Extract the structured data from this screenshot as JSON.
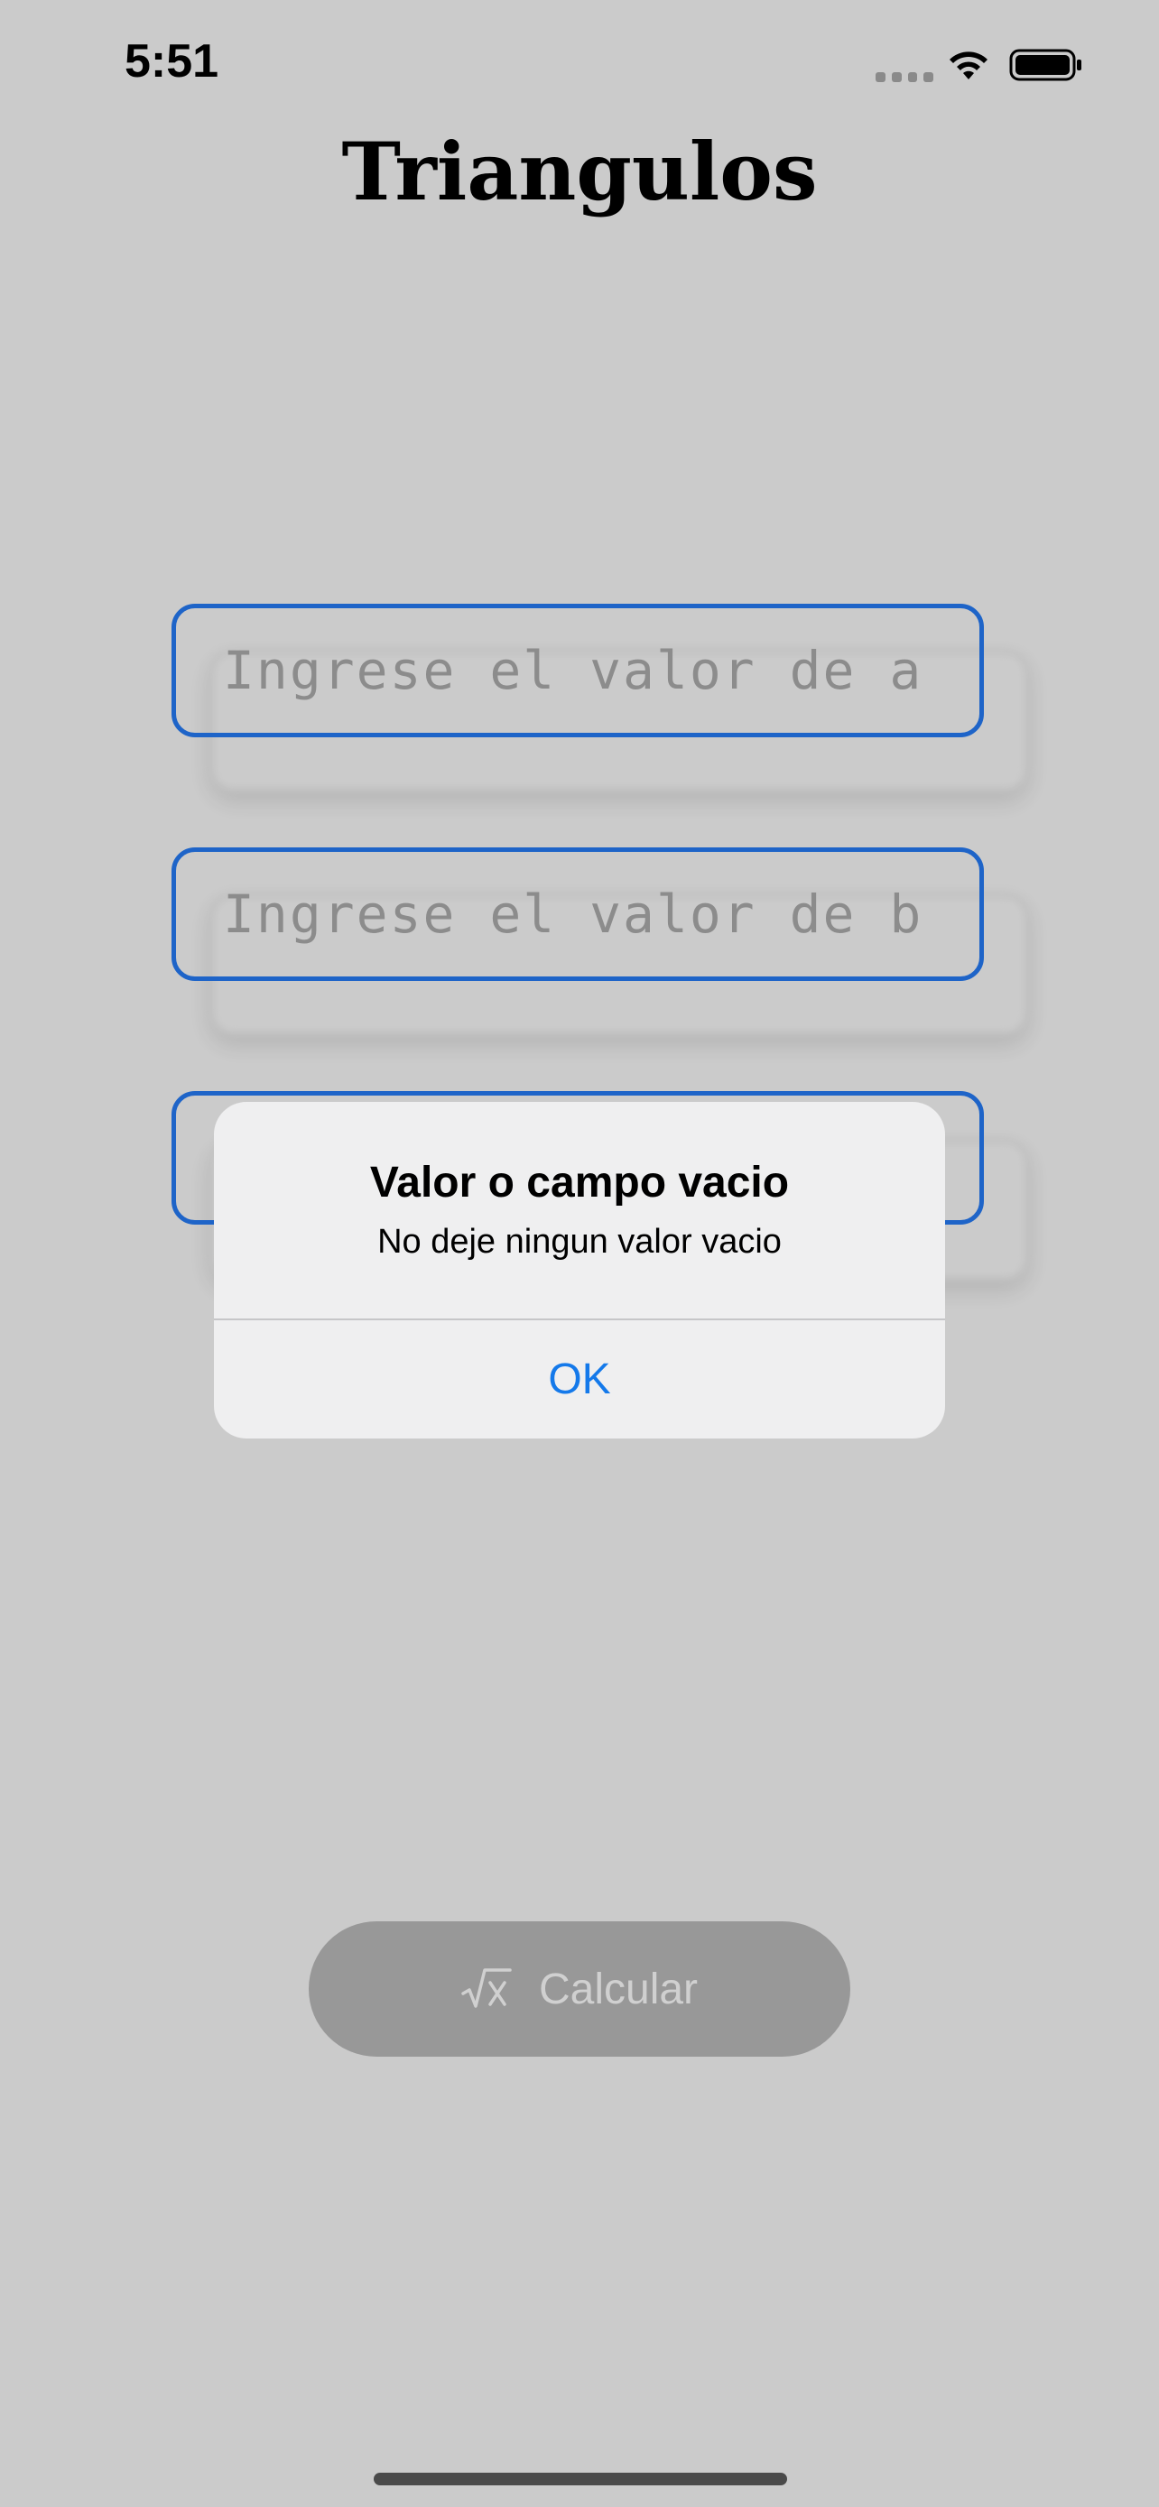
{
  "status_bar": {
    "time": "5:51",
    "signal_icon": "cellular-signal-icon",
    "wifi_icon": "wifi-icon",
    "battery_icon": "battery-icon"
  },
  "app": {
    "title": "Triangulos"
  },
  "fields": [
    {
      "placeholder": "Ingrese el valor de a",
      "value": ""
    },
    {
      "placeholder": "Ingrese el valor de b",
      "value": ""
    },
    {
      "placeholder": "",
      "value": ""
    }
  ],
  "alert": {
    "title": "Valor o campo vacio",
    "message": "No deje ningun valor vacio",
    "ok_label": "OK"
  },
  "calculate_button": {
    "label": "Calcular",
    "icon": "square-root-icon"
  },
  "colors": {
    "background": "#cbcbcb",
    "field_border": "#1e64c8",
    "alert_button": "#1479ea",
    "button_background": "#989898"
  }
}
